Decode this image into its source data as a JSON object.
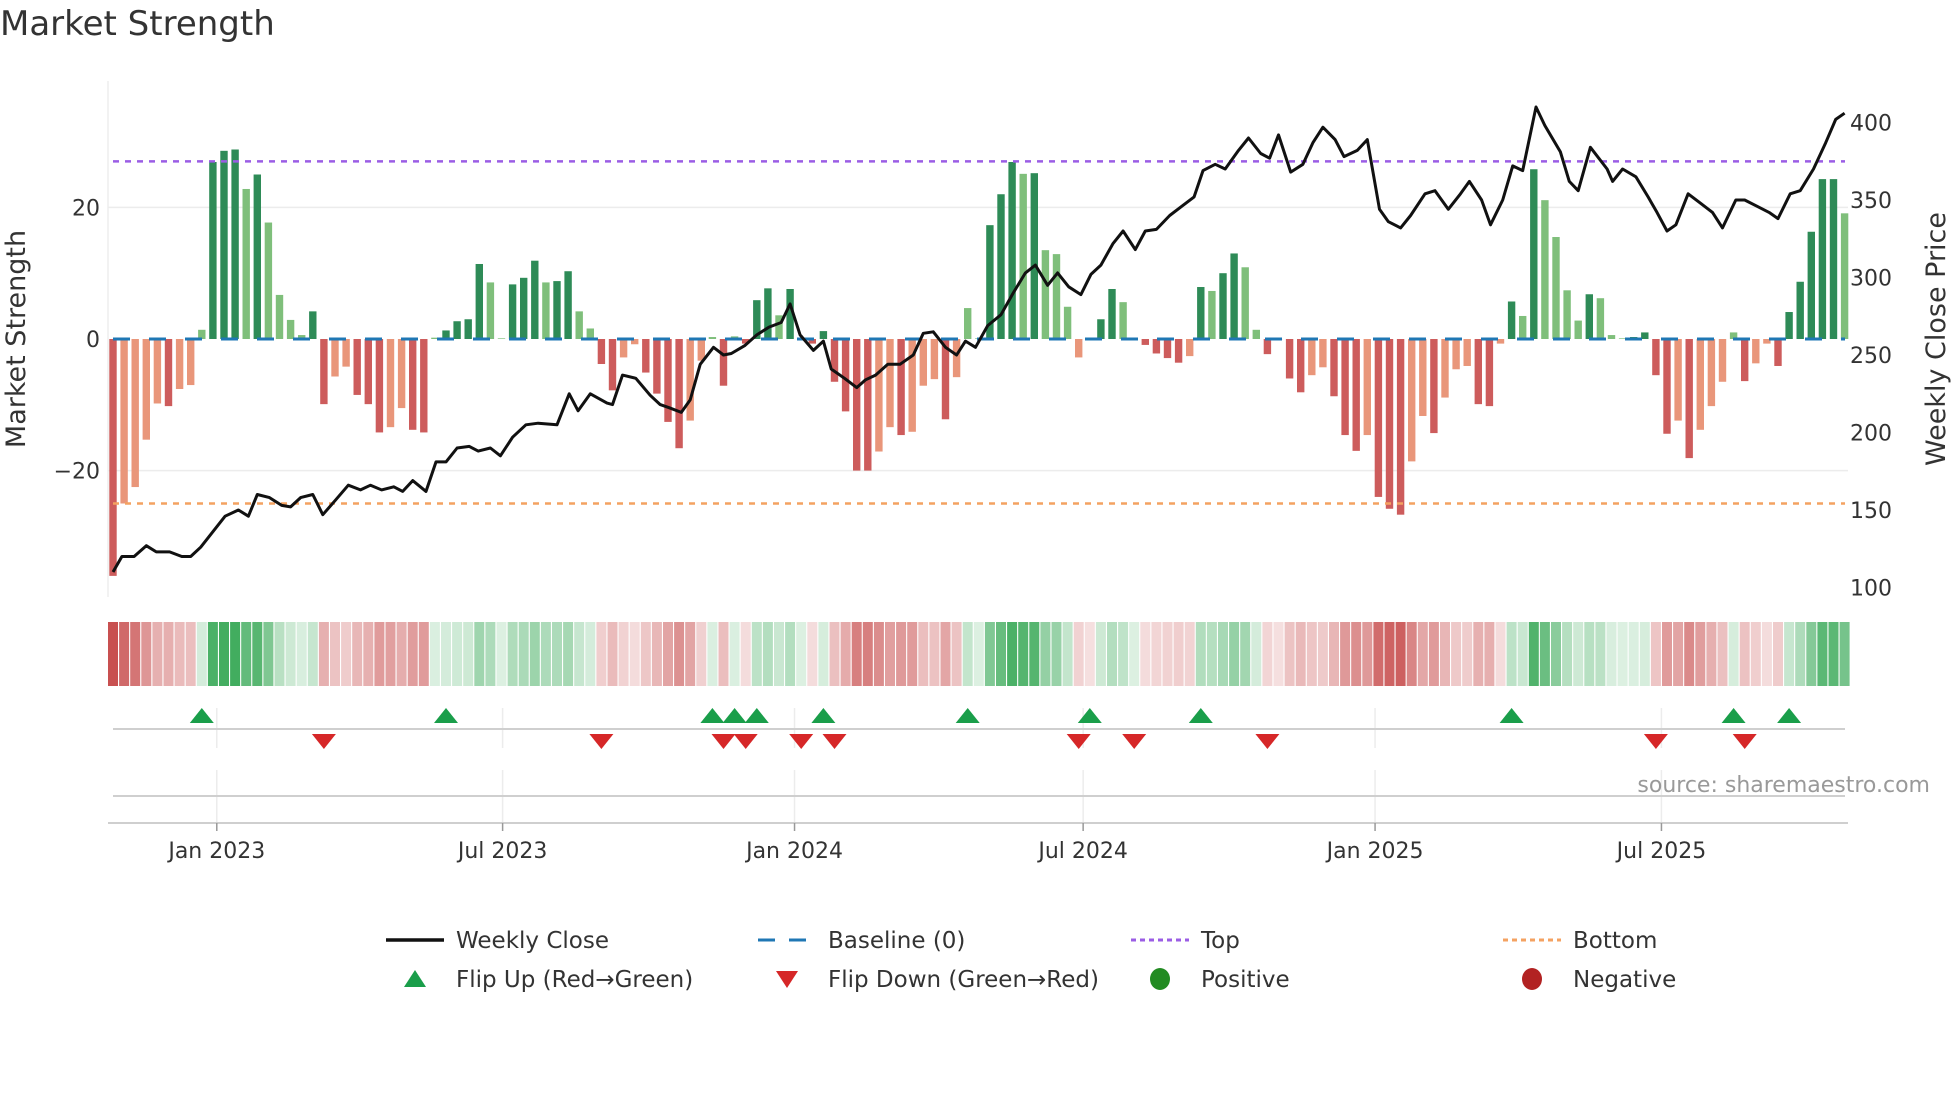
{
  "title": "Market Strength",
  "source": "source: sharemaestro.com",
  "chart_data": {
    "type": "bar",
    "title": "Market Strength",
    "ylabel": "Market Strength",
    "y2label": "Weekly Close Price",
    "ylim": [
      -38,
      41
    ],
    "y2lim": [
      92,
      420
    ],
    "yticks": [
      {
        "v": 20,
        "label": "20"
      },
      {
        "v": 0,
        "label": "0"
      },
      {
        "v": -20,
        "label": "−20"
      }
    ],
    "y2ticks": [
      {
        "v": 400,
        "label": "400"
      },
      {
        "v": 350,
        "label": "350"
      },
      {
        "v": 300,
        "label": "300"
      },
      {
        "v": 250,
        "label": "250"
      },
      {
        "v": 200,
        "label": "200"
      },
      {
        "v": 150,
        "label": "150"
      },
      {
        "v": 100,
        "label": "100"
      }
    ],
    "xticks": [
      {
        "week": 9.35,
        "label": "Jan 2023"
      },
      {
        "week": 35.1,
        "label": "Jul 2023"
      },
      {
        "week": 61.4,
        "label": "Jan 2024"
      },
      {
        "week": 87.4,
        "label": "Jul 2024"
      },
      {
        "week": 113.7,
        "label": "Jan 2025"
      },
      {
        "week": 139.5,
        "label": "Jul 2025"
      }
    ],
    "top_level": 27,
    "bottom_level": -25,
    "baseline": 0,
    "strength": [
      -36,
      -25,
      -22.5,
      -15.3,
      -9.8,
      -10.2,
      -7.6,
      -7.0,
      1.4,
      26.9,
      28.6,
      28.8,
      22.8,
      25,
      17.7,
      6.7,
      2.9,
      0.6,
      4.2,
      -9.9,
      -5.7,
      -4.2,
      -8.5,
      -9.9,
      -14.2,
      -13.4,
      -10.5,
      -13.8,
      -14.2,
      0.2,
      1.3,
      2.7,
      3.0,
      11.4,
      8.6,
      0.1,
      8.3,
      9.3,
      11.9,
      8.6,
      8.8,
      10.3,
      4.2,
      1.6,
      -3.8,
      -7.8,
      -2.8,
      -0.8,
      -5.1,
      -8.3,
      -12.6,
      -16.6,
      -12.4,
      -3.3,
      0.3,
      -7.1,
      0.4,
      -0.7,
      5.9,
      7.7,
      3.6,
      7.6,
      0.1,
      -0.7,
      1.2,
      -6.5,
      -11,
      -20,
      -20,
      -17.1,
      -13.4,
      -14.6,
      -14.1,
      -7.1,
      -6.1,
      -12.2,
      -5.8,
      4.7,
      0.1,
      17.3,
      22,
      26.9,
      25.1,
      25.2,
      13.5,
      12.9,
      4.9,
      -2.8,
      -0.1,
      3.0,
      7.6,
      5.6,
      0.1,
      -0.9,
      -2.2,
      -2.9,
      -3.6,
      -2.6,
      7.9,
      7.3,
      10.0,
      13.0,
      10.9,
      1.4,
      -2.3,
      -0.1,
      -6.0,
      -8.1,
      -5.5,
      -4.3,
      -8.7,
      -14.6,
      -17,
      -14.6,
      -24,
      -25.8,
      -26.7,
      -18.6,
      -11.7,
      -14.3,
      -8.9,
      -4.6,
      -4.1,
      -9.9,
      -10.2,
      -0.7,
      5.7,
      3.5,
      25.8,
      21.1,
      15.5,
      7.4,
      2.8,
      6.8,
      6.2,
      0.6,
      0.1,
      0.3,
      1.0,
      -5.5,
      -14.4,
      -12.4,
      -18.1,
      -13.8,
      -10.2,
      -6.5,
      1.0,
      -6.4,
      -3.7,
      -0.7,
      -4.1,
      4.1,
      8.7,
      16.3,
      24.3,
      24.3,
      19.1
    ],
    "weekly_close": [
      [
        0,
        110
      ],
      [
        0.8,
        120
      ],
      [
        1.9,
        120
      ],
      [
        3.0,
        127
      ],
      [
        3.9,
        123
      ],
      [
        5.1,
        123
      ],
      [
        6.2,
        120
      ],
      [
        7.0,
        120
      ],
      [
        7.9,
        126
      ],
      [
        9.0,
        136
      ],
      [
        10.1,
        146
      ],
      [
        11.3,
        150
      ],
      [
        12.2,
        146
      ],
      [
        13.0,
        160
      ],
      [
        14.1,
        158
      ],
      [
        15.2,
        153
      ],
      [
        16.0,
        152
      ],
      [
        16.9,
        158
      ],
      [
        18.0,
        160
      ],
      [
        18.9,
        147
      ],
      [
        20.0,
        156
      ],
      [
        21.2,
        166
      ],
      [
        22.3,
        163
      ],
      [
        23.2,
        166
      ],
      [
        24.2,
        163
      ],
      [
        25.3,
        165
      ],
      [
        26.1,
        162
      ],
      [
        27.0,
        169
      ],
      [
        28.2,
        162
      ],
      [
        29.1,
        181
      ],
      [
        30.0,
        181
      ],
      [
        31.0,
        190
      ],
      [
        32.1,
        191
      ],
      [
        32.9,
        188
      ],
      [
        34.0,
        190
      ],
      [
        34.9,
        185
      ],
      [
        36.0,
        197
      ],
      [
        37.2,
        205
      ],
      [
        38.3,
        206
      ],
      [
        40.0,
        205
      ],
      [
        41.1,
        225
      ],
      [
        41.9,
        214
      ],
      [
        43.0,
        225
      ],
      [
        44.5,
        219
      ],
      [
        45.0,
        218
      ],
      [
        45.9,
        237
      ],
      [
        47.1,
        235
      ],
      [
        48.4,
        224
      ],
      [
        49.3,
        218
      ],
      [
        50.1,
        216
      ],
      [
        51.2,
        213
      ],
      [
        52.0,
        221
      ],
      [
        52.9,
        244
      ],
      [
        54.1,
        255
      ],
      [
        55.0,
        250
      ],
      [
        55.7,
        251
      ],
      [
        56.9,
        256
      ],
      [
        58.0,
        263
      ],
      [
        59.1,
        268
      ],
      [
        60.2,
        271
      ],
      [
        61.0,
        283
      ],
      [
        61.9,
        263
      ],
      [
        63.1,
        253
      ],
      [
        64.0,
        259
      ],
      [
        64.7,
        241
      ],
      [
        65.9,
        235
      ],
      [
        67.0,
        229
      ],
      [
        67.8,
        234
      ],
      [
        68.7,
        237
      ],
      [
        69.8,
        244
      ],
      [
        70.9,
        244
      ],
      [
        72.1,
        250
      ],
      [
        73.0,
        264
      ],
      [
        73.9,
        265
      ],
      [
        75.0,
        255
      ],
      [
        76.0,
        250
      ],
      [
        76.8,
        259
      ],
      [
        77.7,
        255
      ],
      [
        78.8,
        269
      ],
      [
        80.0,
        276
      ],
      [
        81.1,
        290
      ],
      [
        82.2,
        303
      ],
      [
        83.1,
        308
      ],
      [
        84.2,
        295
      ],
      [
        85.1,
        303
      ],
      [
        86.1,
        294
      ],
      [
        87.2,
        289
      ],
      [
        88.1,
        302
      ],
      [
        89.0,
        308
      ],
      [
        90.1,
        322
      ],
      [
        91.0,
        330
      ],
      [
        92.1,
        318
      ],
      [
        93.0,
        330
      ],
      [
        94.0,
        331
      ],
      [
        95.2,
        340
      ],
      [
        96.3,
        346
      ],
      [
        97.4,
        352
      ],
      [
        98.2,
        369
      ],
      [
        99.3,
        373
      ],
      [
        100.2,
        370
      ],
      [
        101.4,
        382
      ],
      [
        102.3,
        390
      ],
      [
        103.4,
        380
      ],
      [
        104.2,
        377
      ],
      [
        105.0,
        392
      ],
      [
        106.1,
        368
      ],
      [
        107.2,
        373
      ],
      [
        108.1,
        387
      ],
      [
        109.0,
        397
      ],
      [
        110.1,
        389
      ],
      [
        110.9,
        378
      ],
      [
        112.1,
        382
      ],
      [
        113.0,
        389
      ],
      [
        114.1,
        344
      ],
      [
        114.9,
        336
      ],
      [
        116.0,
        332
      ],
      [
        116.9,
        340
      ],
      [
        118.2,
        354
      ],
      [
        119.1,
        356
      ],
      [
        120.3,
        344
      ],
      [
        121.4,
        354
      ],
      [
        122.2,
        362
      ],
      [
        123.3,
        350
      ],
      [
        124.1,
        334
      ],
      [
        125.2,
        350
      ],
      [
        126.1,
        372
      ],
      [
        127.0,
        369
      ],
      [
        128.2,
        410
      ],
      [
        129.0,
        398
      ],
      [
        130.4,
        381
      ],
      [
        131.2,
        362
      ],
      [
        132.0,
        356
      ],
      [
        133.1,
        384
      ],
      [
        134.6,
        370
      ],
      [
        135.1,
        362
      ],
      [
        136.0,
        370
      ],
      [
        137.2,
        365
      ],
      [
        138.3,
        352
      ],
      [
        139.1,
        342
      ],
      [
        140.0,
        330
      ],
      [
        140.8,
        334
      ],
      [
        141.9,
        354
      ],
      [
        143.0,
        348
      ],
      [
        144.1,
        342
      ],
      [
        145.0,
        332
      ],
      [
        146.2,
        350
      ],
      [
        147.0,
        350
      ],
      [
        148.1,
        346
      ],
      [
        149.2,
        342
      ],
      [
        150.0,
        338
      ],
      [
        151.1,
        354
      ],
      [
        152.0,
        356
      ],
      [
        153.2,
        370
      ],
      [
        154.3,
        387
      ],
      [
        155.2,
        402
      ],
      [
        156.0,
        406
      ]
    ],
    "flip_up_weeks": [
      8,
      30,
      54,
      56,
      58,
      64,
      77,
      88,
      98,
      126,
      146,
      151
    ],
    "flip_down_weeks": [
      19,
      44,
      55,
      57,
      62,
      65,
      87,
      92,
      104,
      139,
      147
    ],
    "legend": {
      "placement": "bottom",
      "items": [
        {
          "label": "Weekly Close",
          "kind": "line-solid",
          "color": "#111111"
        },
        {
          "label": "Baseline (0)",
          "kind": "line-dashed",
          "color": "#1f77b4"
        },
        {
          "label": "Top",
          "kind": "line-dotted",
          "color": "#9b5de5"
        },
        {
          "label": "Bottom",
          "kind": "line-dotted",
          "color": "#f4a261"
        },
        {
          "label": "Flip Up (Red→Green)",
          "kind": "triangle-up",
          "color": "#1a9e4a"
        },
        {
          "label": "Flip Down (Green→Red)",
          "kind": "triangle-down",
          "color": "#d62728"
        },
        {
          "label": "Positive",
          "kind": "circle",
          "color": "#228b22"
        },
        {
          "label": "Negative",
          "kind": "circle",
          "color": "#b22222"
        }
      ]
    },
    "colors": {
      "pos_rising": "#2e8b57",
      "pos_falling": "#7fbf7b",
      "neg_rising": "#cd5c5c",
      "neg_falling": "#e9967a",
      "baseline": "#1f77b4",
      "top": "#9b5de5",
      "bottom": "#f4a261",
      "price": "#111111",
      "flip_up": "#1a9e4a",
      "flip_down": "#d62728",
      "strip_pos": "60,170,90",
      "strip_neg": "200,80,80"
    }
  }
}
